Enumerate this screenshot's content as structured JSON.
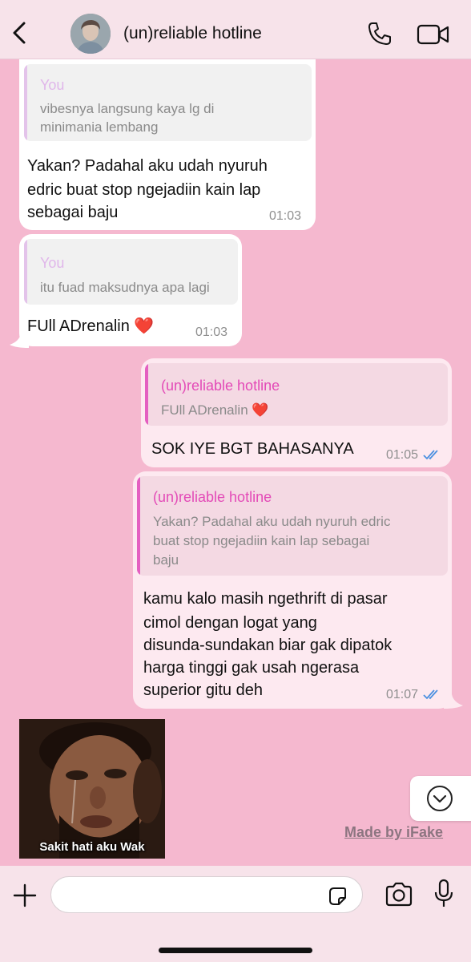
{
  "header": {
    "title": "(un)reliable hotline"
  },
  "messages": [
    {
      "direction": "in",
      "reply_to": {
        "name": "You",
        "text_lines": [
          "vibesnya langsung kaya lg di",
          "minimania lembang"
        ]
      },
      "lines": [
        "Yakan? Padahal aku udah nyuruh",
        "edric buat stop ngejadiin kain lap",
        "sebagai baju"
      ],
      "time": "01:03"
    },
    {
      "direction": "in",
      "reply_to": {
        "name": "You",
        "text_lines": [
          "itu fuad maksudnya apa lagi"
        ]
      },
      "lines": [
        "FUll ADrenalin ❤️"
      ],
      "time": "01:03"
    },
    {
      "direction": "out",
      "reply_to": {
        "name": "(un)reliable hotline",
        "text_lines": [
          "FUll ADrenalin ❤️"
        ]
      },
      "lines": [
        "SOK IYE BGT BAHASANYA"
      ],
      "time": "01:05"
    },
    {
      "direction": "out",
      "reply_to": {
        "name": "(un)reliable hotline",
        "text_lines": [
          "Yakan? Padahal aku udah nyuruh edric",
          "buat stop ngejadiin kain lap sebagai",
          "baju"
        ]
      },
      "lines": [
        "kamu kalo masih ngethrift di pasar",
        "cimol dengan logat yang",
        "disunda-sundakan biar gak dipatok",
        "harga tinggi gak usah ngerasa",
        "superior gitu deh"
      ],
      "time": "01:07"
    }
  ],
  "sticker": {
    "caption": "Sakit hati aku Wak"
  },
  "watermark": "Made by iFake",
  "composer": {
    "placeholder": ""
  },
  "colors": {
    "chat_background": "#f5b8cf",
    "header_background": "#f7e3ea",
    "outgoing_bubble": "#fde9f0",
    "incoming_bubble": "#ffffff",
    "quote_accent_out": "#e34ab7",
    "quote_accent_in": "#e0b6ea",
    "read_ticks": "#4a8fe0"
  },
  "icons": [
    "back-chevron-icon",
    "phone-icon",
    "video-camera-icon",
    "scroll-down-chevron-icon",
    "plus-icon",
    "sticker-icon",
    "camera-icon",
    "microphone-icon"
  ]
}
